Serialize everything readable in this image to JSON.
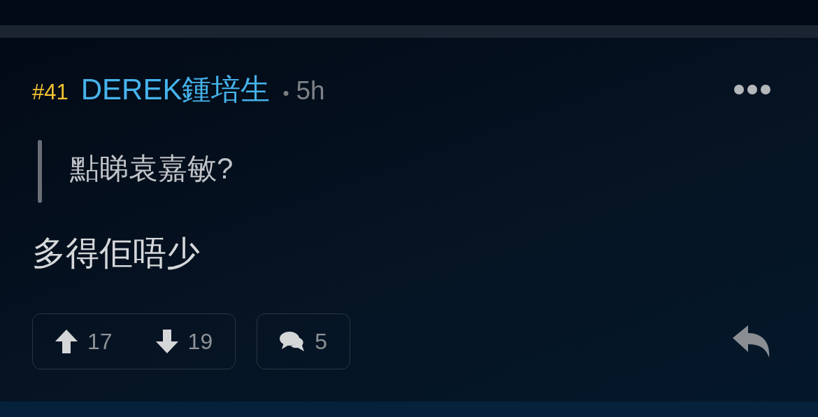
{
  "post": {
    "floor": "#41",
    "author": "DEREK鍾培生",
    "separator": "•",
    "time": "5h",
    "quote": "點睇袁嘉敏?",
    "body": "多得佢唔少"
  },
  "actions": {
    "upvotes": "17",
    "downvotes": "19",
    "replies": "5"
  }
}
